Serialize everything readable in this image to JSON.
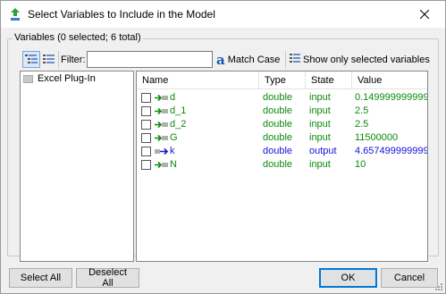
{
  "window": {
    "title": "Select Variables to Include in the Model"
  },
  "group": {
    "legend": "Variables (0 selected; 6 total)"
  },
  "toolbar": {
    "filter_label": "Filter:",
    "filter_value": "",
    "match_case_label": "Match Case",
    "show_selected_label": "Show only selected variables"
  },
  "tree": {
    "items": [
      {
        "label": "Excel Plug-In"
      }
    ]
  },
  "grid": {
    "columns": [
      "Name",
      "Type",
      "State",
      "Value"
    ],
    "rows": [
      {
        "name": "d",
        "type": "double",
        "state": "input",
        "value": "0.149999999999...",
        "icon": "input-variable-icon",
        "color": "#0b8a0b"
      },
      {
        "name": "d_1",
        "type": "double",
        "state": "input",
        "value": "2.5",
        "icon": "input-variable-icon",
        "color": "#0b8a0b"
      },
      {
        "name": "d_2",
        "type": "double",
        "state": "input",
        "value": "2.5",
        "icon": "input-variable-icon",
        "color": "#0b8a0b"
      },
      {
        "name": "G",
        "type": "double",
        "state": "input",
        "value": "11500000",
        "icon": "input-variable-icon",
        "color": "#0b8a0b"
      },
      {
        "name": "k",
        "type": "double",
        "state": "output",
        "value": "4.657499999999...",
        "icon": "output-variable-icon",
        "color": "#1414d8"
      },
      {
        "name": "N",
        "type": "double",
        "state": "input",
        "value": "10",
        "icon": "input-variable-icon",
        "color": "#0b8a0b"
      }
    ]
  },
  "buttons": {
    "select_all": "Select All",
    "deselect_all": "Deselect All",
    "ok": "OK",
    "cancel": "Cancel"
  },
  "colors": {
    "input": "#0b8a0b",
    "output": "#1414d8",
    "accent": "#0078d7"
  }
}
